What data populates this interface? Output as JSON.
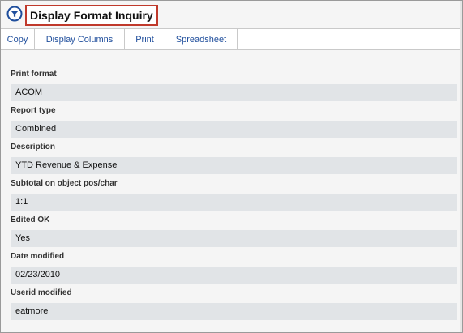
{
  "window": {
    "title": "Display Format Inquiry",
    "title_icon": "filter-funnel-icon",
    "accent_color": "#1f4e9c",
    "highlight_color": "#c0392b"
  },
  "toolbar": {
    "copy_label": "Copy",
    "display_columns_label": "Display Columns",
    "print_label": "Print",
    "spreadsheet_label": "Spreadsheet"
  },
  "fields": [
    {
      "label": "Print format",
      "value": "ACOM"
    },
    {
      "label": "Report type",
      "value": "Combined"
    },
    {
      "label": "Description",
      "value": "YTD Revenue & Expense"
    },
    {
      "label": "Subtotal on object pos/char",
      "value": "1:1"
    },
    {
      "label": "Edited OK",
      "value": "Yes"
    },
    {
      "label": "Date modified",
      "value": "02/23/2010"
    },
    {
      "label": "Userid modified",
      "value": "eatmore"
    }
  ]
}
